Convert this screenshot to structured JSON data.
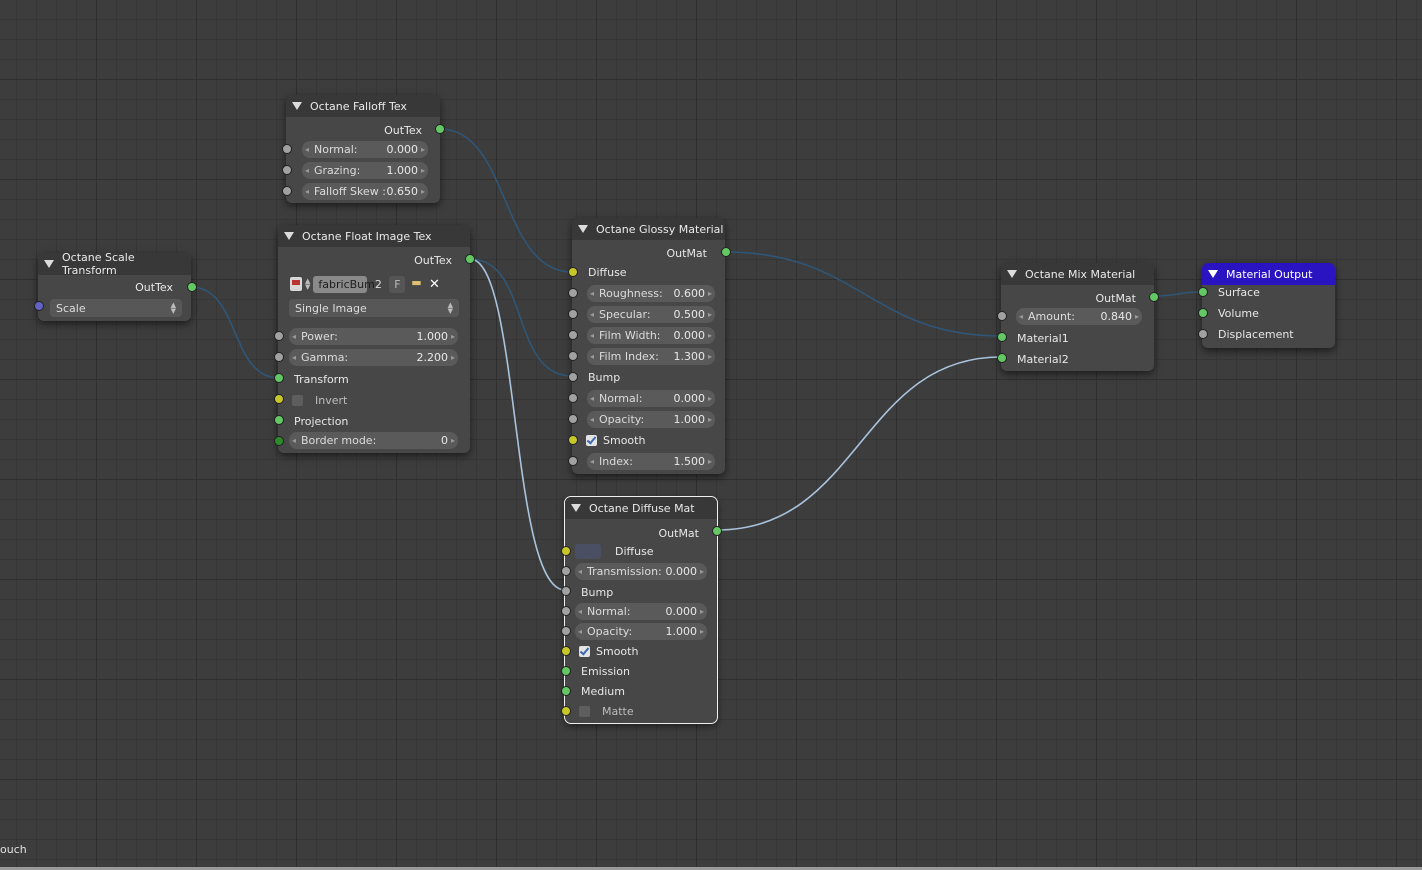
{
  "nodes": {
    "scale_transform": {
      "title": "Octane Scale Transform",
      "output": "OutTex",
      "scale_label": "Scale"
    },
    "falloff_tex": {
      "title": "Octane Falloff Tex",
      "output": "OutTex",
      "fields": [
        {
          "label": "Normal:",
          "value": "0.000"
        },
        {
          "label": "Grazing:",
          "value": "1.000"
        },
        {
          "label": "Falloff Skew :",
          "value": "0.650"
        }
      ]
    },
    "float_image_tex": {
      "title": "Octane Float Image Tex",
      "output": "OutTex",
      "image_name": "fabricBum",
      "users": "2",
      "fake_user": "F",
      "source": "Single Image",
      "fields": [
        {
          "label": "Power:",
          "value": "1.000"
        },
        {
          "label": "Gamma:",
          "value": "2.200"
        }
      ],
      "transform": "Transform",
      "invert": "Invert",
      "projection": "Projection",
      "border_mode": {
        "label": "Border mode:",
        "value": "0"
      }
    },
    "glossy_material": {
      "title": "Octane Glossy Material",
      "output": "OutMat",
      "diffuse": "Diffuse",
      "fields": [
        {
          "label": "Roughness:",
          "value": "0.600"
        },
        {
          "label": "Specular:",
          "value": "0.500"
        },
        {
          "label": "Film Width:",
          "value": "0.000"
        },
        {
          "label": "Film Index:",
          "value": "1.300"
        }
      ],
      "bump": "Bump",
      "fields2": [
        {
          "label": "Normal:",
          "value": "0.000"
        },
        {
          "label": "Opacity:",
          "value": "1.000"
        }
      ],
      "smooth": "Smooth",
      "smooth_checked": true,
      "index": {
        "label": "Index:",
        "value": "1.500"
      }
    },
    "diffuse_mat": {
      "title": "Octane Diffuse Mat",
      "output": "OutMat",
      "diffuse": "Diffuse",
      "diffuse_color": "#4a4f64",
      "transmission": {
        "label": "Transmission:",
        "value": "0.000"
      },
      "bump": "Bump",
      "fields": [
        {
          "label": "Normal:",
          "value": "0.000"
        },
        {
          "label": "Opacity:",
          "value": "1.000"
        }
      ],
      "smooth": "Smooth",
      "smooth_checked": true,
      "emission": "Emission",
      "medium": "Medium",
      "matte": "Matte",
      "matte_checked": false
    },
    "mix_material": {
      "title": "Octane Mix Material",
      "output": "OutMat",
      "amount": {
        "label": "Amount:",
        "value": "0.840"
      },
      "material1": "Material1",
      "material2": "Material2"
    },
    "material_output": {
      "title": "Material Output",
      "header_color": "#2a14c2",
      "inputs": [
        "Surface",
        "Volume",
        "Displacement"
      ]
    }
  },
  "status_text": "ouch",
  "colors": {
    "socket_green": "#63c763",
    "socket_grey": "#a1a1a1",
    "socket_yellow": "#c7c729",
    "socket_blue": "#6363c7",
    "wire": "#2f5677",
    "wire_selected": "#a9c3dd"
  }
}
